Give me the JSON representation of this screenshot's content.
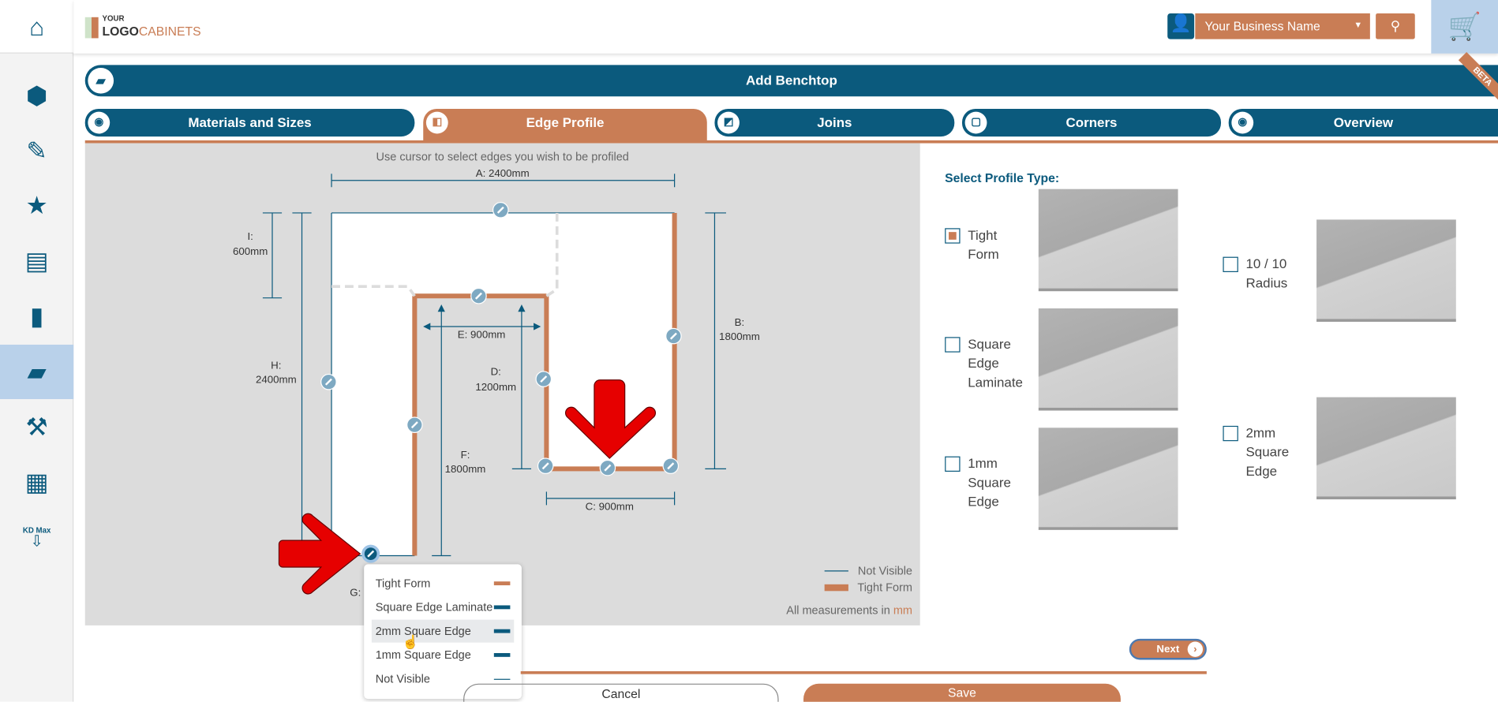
{
  "colors": {
    "primary": "#0b5a7d",
    "accent": "#c97d55",
    "canvas": "#dcdcdc",
    "arrow": "#e60000"
  },
  "sidebar": {
    "items": [
      {
        "icon": "home-icon"
      },
      {
        "icon": "room-icon"
      },
      {
        "icon": "design-tools-icon"
      },
      {
        "icon": "favourites-icon"
      },
      {
        "icon": "cabinet-icon"
      },
      {
        "icon": "panel-icon"
      },
      {
        "icon": "benchtop-icon",
        "active": true
      },
      {
        "icon": "hardware-icon"
      },
      {
        "icon": "grid-icon"
      },
      {
        "icon": "kd-max-icon",
        "label": "KD Max"
      }
    ]
  },
  "header": {
    "logo": {
      "line1": "YOUR",
      "line2": "LOGO",
      "line3": "CABINETS"
    },
    "business": "Your Business Name"
  },
  "panel": {
    "title": "Add Benchtop",
    "badge": "BETA"
  },
  "tabs": [
    {
      "label": "Materials and Sizes"
    },
    {
      "label": "Edge Profile",
      "active": true
    },
    {
      "label": "Joins"
    },
    {
      "label": "Corners"
    },
    {
      "label": "Overview"
    }
  ],
  "diagram": {
    "instruction": "Use cursor to select edges you wish to be profiled",
    "dims": {
      "A": "A: 2400mm",
      "I1": "I:",
      "I2": "600mm",
      "H1": "H:",
      "H2": "2400mm",
      "B1": "B:",
      "B2": "1800mm",
      "E": "E: 900mm",
      "D1": "D:",
      "D2": "1200mm",
      "F1": "F:",
      "F2": "1800mm",
      "C": "C: 900mm",
      "G": "G:"
    },
    "legend": {
      "not_visible": "Not Visible",
      "tight_form": "Tight Form",
      "note": "All measurements in ",
      "unit": "mm"
    }
  },
  "popup": {
    "items": [
      {
        "label": "Tight Form",
        "color": "#c97d55"
      },
      {
        "label": "Square Edge Laminate",
        "color": "#0b5a7d"
      },
      {
        "label": "2mm Square Edge",
        "color": "#0b5a7d",
        "hover": true
      },
      {
        "label": "1mm Square Edge",
        "color": "#0b5a7d"
      },
      {
        "label": "Not Visible",
        "color": "#0b5a7d"
      }
    ]
  },
  "profiles": {
    "title": "Select Profile Type:",
    "options": [
      {
        "label": [
          "Tight",
          "Form"
        ],
        "checked": true
      },
      {
        "label": [
          "10 / 10",
          "Radius"
        ],
        "checked": false
      },
      {
        "label": [
          "Square",
          "Edge",
          "Laminate"
        ],
        "checked": false
      },
      {
        "label": [
          "2mm",
          "Square",
          "Edge"
        ],
        "checked": false
      },
      {
        "label": [
          "1mm",
          "Square",
          "Edge"
        ],
        "checked": false
      }
    ]
  },
  "footer": {
    "next": "Next",
    "cancel": "Cancel",
    "save": "Save"
  }
}
